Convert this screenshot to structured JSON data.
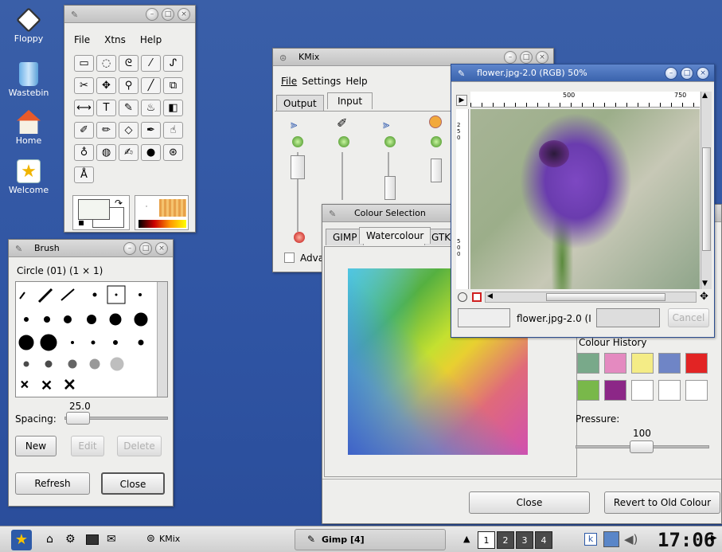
{
  "desktop": {
    "icons": [
      {
        "label": "Floppy",
        "icon": "floppy-icon"
      },
      {
        "label": "Wastebin",
        "icon": "wastebin-icon"
      },
      {
        "label": "Home",
        "icon": "home-icon"
      },
      {
        "label": "Welcome",
        "icon": "welcome-icon"
      }
    ]
  },
  "toolbox": {
    "menu": [
      "File",
      "Xtns",
      "Help"
    ],
    "tools": [
      "▭",
      "◌",
      "ᘓ",
      "⁄",
      "ᔑ",
      "✂",
      "✥",
      "⚲",
      "╱",
      "⧉",
      "⟷",
      "T",
      "✎",
      "♨",
      "◧",
      "✐",
      "✏",
      "◇",
      "✒",
      "☝",
      "♁",
      "◍",
      "✍",
      "●",
      "⊛",
      "Å"
    ]
  },
  "kmix": {
    "title": "KMix",
    "menu": [
      "File",
      "Settings",
      "Help"
    ],
    "tabs": [
      "Output",
      "Input"
    ],
    "checkbox_label": "Adva"
  },
  "brush": {
    "title": "Brush",
    "header": "Circle (01)  (1 × 1)",
    "spacing_value": "25.0",
    "spacing_label": "Spacing:",
    "new": "New",
    "edit": "Edit",
    "delete": "Delete",
    "refresh": "Refresh",
    "close": "Close"
  },
  "colour": {
    "title": "Colour Selection",
    "tabs": [
      "GIMP",
      "Watercolour",
      "GTK"
    ],
    "history_label": "Colour History",
    "history_colors": [
      "#79a98a",
      "#e48ac0",
      "#f4ec86",
      "#6f85c6",
      "#e22424",
      "#79b84a",
      "#8c2787",
      "#ffffff",
      "#ffffff",
      "#ffffff"
    ],
    "pressure_label": "Pressure:",
    "pressure_value": "100",
    "close": "Close",
    "revert": "Revert to Old Colour"
  },
  "image": {
    "title": "flower.jpg-2.0 (RGB) 50%",
    "ruler_500": "500",
    "ruler_750": "750",
    "vruler_top": "250",
    "vruler_bot": "500",
    "status": "flower.jpg-2.0 (I",
    "cancel": "Cancel"
  },
  "taskbar": {
    "kmix": "KMix",
    "gimp": "Gimp [4]",
    "pages": [
      "1",
      "2",
      "3",
      "4"
    ],
    "clock": "17:06"
  }
}
